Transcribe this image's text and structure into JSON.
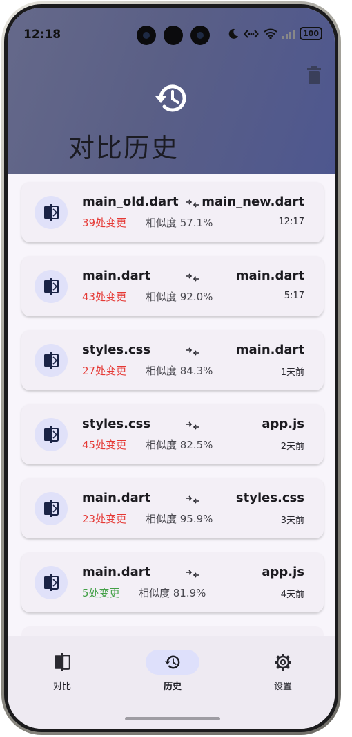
{
  "status_bar": {
    "time": "12:18",
    "battery": "100"
  },
  "header": {
    "title": "对比历史",
    "icons": [
      "history-icon",
      "trash-icon"
    ]
  },
  "history": [
    {
      "left": "main_old.dart",
      "right": "main_new.dart",
      "changes": "39处变更",
      "similarity": "相似度 57.1%",
      "time": "12:17",
      "status": "bad"
    },
    {
      "left": "main.dart",
      "right": "main.dart",
      "changes": "43处变更",
      "similarity": "相似度 92.0%",
      "time": "5:17",
      "status": "bad"
    },
    {
      "left": "styles.css",
      "right": "main.dart",
      "changes": "27处变更",
      "similarity": "相似度 84.3%",
      "time": "1天前",
      "status": "bad"
    },
    {
      "left": "styles.css",
      "right": "app.js",
      "changes": "45处变更",
      "similarity": "相似度 82.5%",
      "time": "2天前",
      "status": "bad"
    },
    {
      "left": "main.dart",
      "right": "styles.css",
      "changes": "23处变更",
      "similarity": "相似度 95.9%",
      "time": "3天前",
      "status": "bad"
    },
    {
      "left": "main.dart",
      "right": "app.js",
      "changes": "5处变更",
      "similarity": "相似度 81.9%",
      "time": "4天前",
      "status": "good"
    }
  ],
  "nav": {
    "compare": "对比",
    "history": "历史",
    "settings": "设置"
  },
  "colors": {
    "header_start": "#65698a",
    "header_end": "#4e578f",
    "change_bad": "#e53935",
    "change_good": "#43a047",
    "card_bg": "#f3eff6",
    "icon_circle": "#e0e1f9",
    "nav_active": "#dee0fb"
  }
}
